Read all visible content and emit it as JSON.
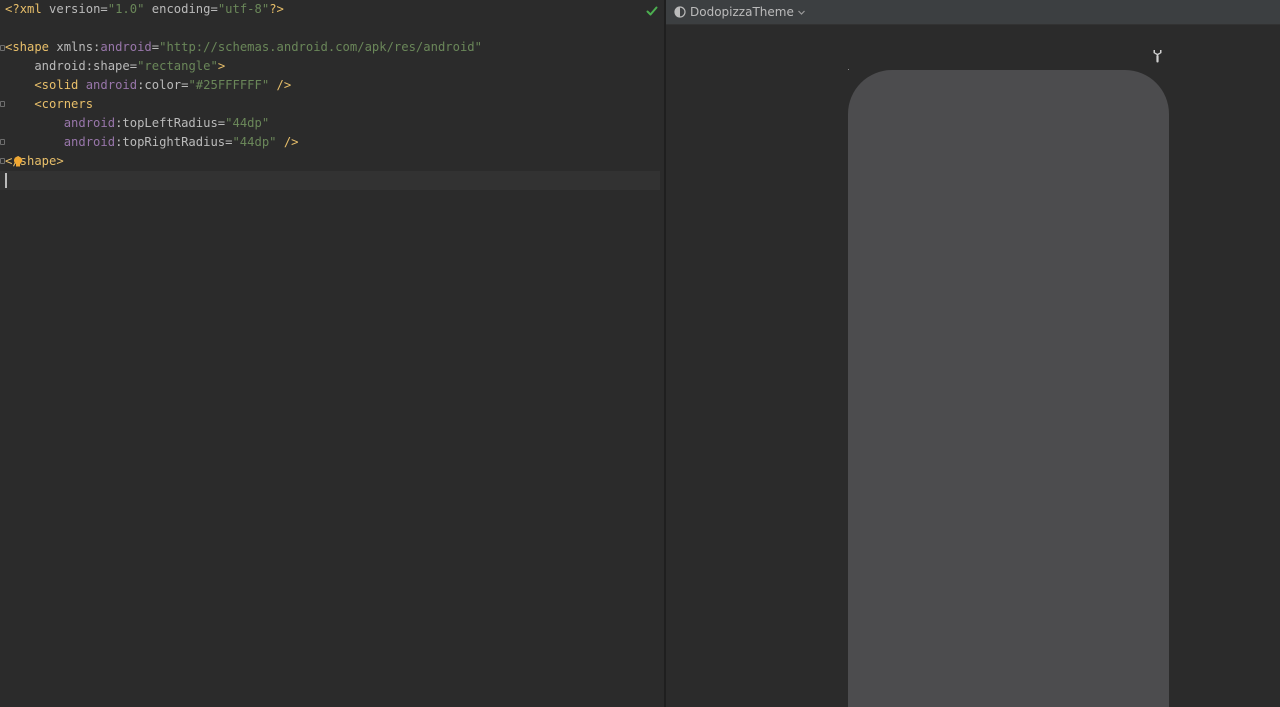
{
  "editor": {
    "lines": [
      [
        {
          "c": "t-punc",
          "t": "<?"
        },
        {
          "c": "t-tag",
          "t": "xml"
        },
        {
          "c": "t-attr",
          "t": " version"
        },
        {
          "c": "t-attr",
          "t": "="
        },
        {
          "c": "t-val",
          "t": "\"1.0\""
        },
        {
          "c": "t-attr",
          "t": " encoding"
        },
        {
          "c": "t-attr",
          "t": "="
        },
        {
          "c": "t-val",
          "t": "\"utf-8\""
        },
        {
          "c": "t-punc",
          "t": "?>"
        }
      ],
      [],
      [
        {
          "c": "t-tag",
          "t": "<shape "
        },
        {
          "c": "t-attr",
          "t": "xmlns:"
        },
        {
          "c": "t-ns",
          "t": "android"
        },
        {
          "c": "t-attr",
          "t": "="
        },
        {
          "c": "t-val",
          "t": "\"http://schemas.android.com/apk/res/android\""
        }
      ],
      [
        {
          "c": "t-attr",
          "t": "    android:shape"
        },
        {
          "c": "t-attr",
          "t": "="
        },
        {
          "c": "t-val",
          "t": "\"rectangle\""
        },
        {
          "c": "t-tag",
          "t": ">"
        }
      ],
      [
        {
          "c": "t-tag",
          "t": "    <solid "
        },
        {
          "c": "t-ns",
          "t": "android"
        },
        {
          "c": "t-attr",
          "t": ":color"
        },
        {
          "c": "t-attr",
          "t": "="
        },
        {
          "c": "t-val",
          "t": "\"#25FFFFFF\""
        },
        {
          "c": "t-tag",
          "t": " />"
        }
      ],
      [
        {
          "c": "t-tag",
          "t": "    <corners"
        }
      ],
      [
        {
          "c": "t-ns",
          "t": "        android"
        },
        {
          "c": "t-attr",
          "t": ":topLeftRadius"
        },
        {
          "c": "t-attr",
          "t": "="
        },
        {
          "c": "t-val",
          "t": "\"44dp\""
        }
      ],
      [
        {
          "c": "t-ns",
          "t": "        android"
        },
        {
          "c": "t-attr",
          "t": ":topRightRadius"
        },
        {
          "c": "t-attr",
          "t": "="
        },
        {
          "c": "t-val",
          "t": "\"44dp\""
        },
        {
          "c": "t-tag",
          "t": " />"
        }
      ],
      [
        {
          "c": "t-tag",
          "t": "</shape>"
        }
      ],
      []
    ],
    "inspection_status": "check-icon",
    "intention_icon": "bulb-icon"
  },
  "preview": {
    "theme_label": "DodopizzaTheme",
    "theme_icon": "theme-circle-icon",
    "dropdown_icon": "chevron-down-icon",
    "settings_icon": "wrench-icon",
    "shape_fill_color": "#4c4c4e",
    "shape_corner_radius": "44dp"
  },
  "colors": {
    "background": "#2b2b2b",
    "toolbar": "#3c3f41",
    "tag": "#e8bf6a",
    "namespace": "#9876aa",
    "value": "#6a8759",
    "attribute": "#bababa",
    "ok": "#4caf50"
  }
}
